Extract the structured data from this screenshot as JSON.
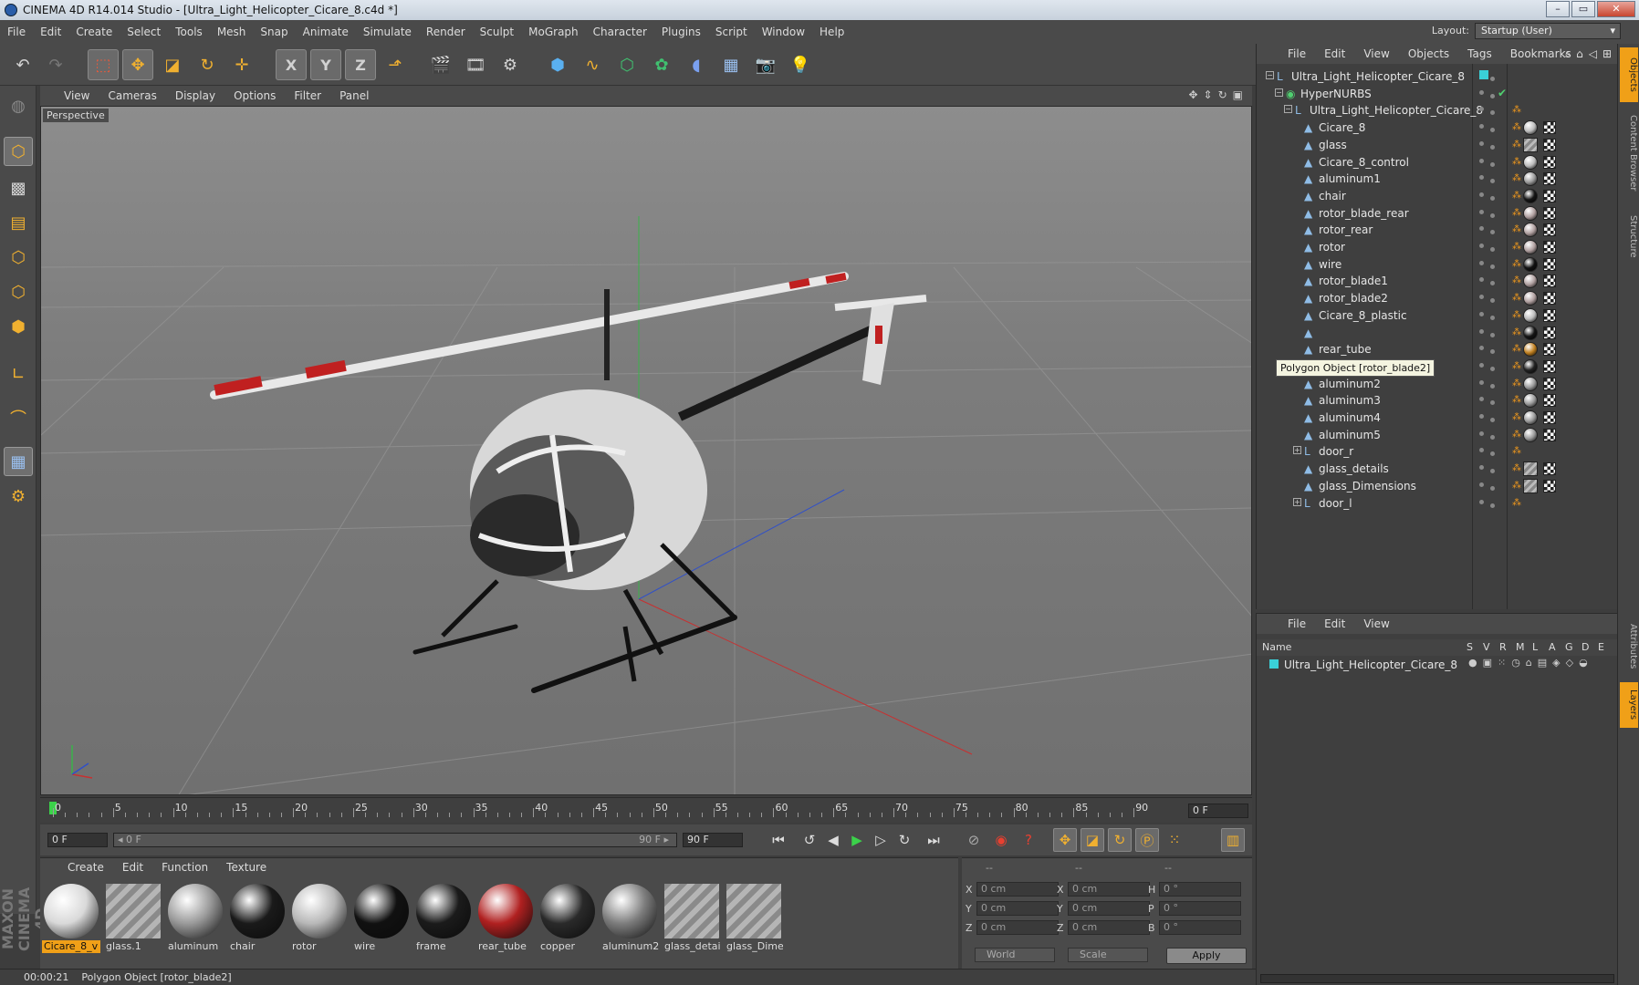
{
  "window": {
    "title": "CINEMA 4D R14.014 Studio - [Ultra_Light_Helicopter_Cicare_8.c4d *]",
    "buttons": [
      "–",
      "▭",
      "✕"
    ]
  },
  "menubar": [
    "File",
    "Edit",
    "Create",
    "Select",
    "Tools",
    "Mesh",
    "Snap",
    "Animate",
    "Simulate",
    "Render",
    "Sculpt",
    "MoGraph",
    "Character",
    "Plugins",
    "Script",
    "Window",
    "Help"
  ],
  "layout": {
    "label": "Layout:",
    "value": "Startup (User)"
  },
  "toolbar_icons": [
    "undo-icon",
    "redo-icon",
    "live-selection-icon",
    "move-icon",
    "scale-icon",
    "rotate-icon",
    "add-icon",
    "x-axis-icon",
    "y-axis-icon",
    "z-axis-icon",
    "coordinate-system-icon",
    "render-view-icon",
    "render-picture-viewer-icon",
    "edit-render-settings-icon",
    "cube-icon",
    "spline-pen-icon",
    "nurbs-icon",
    "array-icon",
    "deformer-icon",
    "floor-icon",
    "camera-icon",
    "light-icon"
  ],
  "toolbar_glyphs": {
    "x_axis": "X",
    "y_axis": "Y",
    "z_axis": "Z"
  },
  "viewport": {
    "menu": [
      "View",
      "Cameras",
      "Display",
      "Options",
      "Filter",
      "Panel"
    ],
    "label": "Perspective"
  },
  "timeline": {
    "ticks": [
      "0",
      "5",
      "10",
      "15",
      "20",
      "25",
      "30",
      "35",
      "40",
      "45",
      "50",
      "55",
      "60",
      "65",
      "70",
      "75",
      "80",
      "85",
      "90"
    ],
    "current_frame": "0 F"
  },
  "transport": {
    "start_frame": "0 F",
    "range_start": "◂ 0 F",
    "range_end": "90 F ▸",
    "end_frame": "90 F"
  },
  "materials": {
    "menu": [
      "Create",
      "Edit",
      "Function",
      "Texture"
    ],
    "items": [
      {
        "label": "Cicare_8_v",
        "color": "#d9d9d9",
        "selected": true
      },
      {
        "label": "glass.1",
        "color": "striped",
        "selected": false
      },
      {
        "label": "aluminum",
        "color": "#9a9a9a",
        "selected": false
      },
      {
        "label": "chair",
        "color": "#1a1a1a",
        "selected": false
      },
      {
        "label": "rotor",
        "color": "#b8b8b8",
        "selected": false
      },
      {
        "label": "wire",
        "color": "#111111",
        "selected": false
      },
      {
        "label": "frame",
        "color": "#1b1b1b",
        "selected": false
      },
      {
        "label": "rear_tube",
        "color": "#b02020",
        "selected": false
      },
      {
        "label": "copper",
        "color": "#2a2a2a",
        "selected": false
      },
      {
        "label": "aluminum2",
        "color": "#7d7d7d",
        "selected": false
      },
      {
        "label": "glass_detai",
        "color": "striped",
        "selected": false
      },
      {
        "label": "glass_Dime",
        "color": "striped",
        "selected": false
      }
    ]
  },
  "coordinates": {
    "headers": [
      "--",
      "--",
      "--"
    ],
    "rows": [
      {
        "a": "X",
        "av": "0 cm",
        "b": "X",
        "bv": "0 cm",
        "c": "H",
        "cv": "0 °"
      },
      {
        "a": "Y",
        "av": "0 cm",
        "b": "Y",
        "bv": "0 cm",
        "c": "P",
        "cv": "0 °"
      },
      {
        "a": "Z",
        "av": "0 cm",
        "b": "Z",
        "bv": "0 cm",
        "c": "B",
        "cv": "0 °"
      }
    ],
    "world": "World",
    "scale": "Scale",
    "apply": "Apply"
  },
  "status": {
    "time": "00:00:21",
    "message": "Polygon Object [rotor_blade2]"
  },
  "objects_panel": {
    "menu": [
      "File",
      "Edit",
      "View",
      "Objects",
      "Tags",
      "Bookmarks"
    ],
    "tree": [
      {
        "name": "Ultra_Light_Helicopter_Cicare_8",
        "depth": 0,
        "icon": "null",
        "tag": "cyan"
      },
      {
        "name": "HyperNURBS",
        "depth": 1,
        "icon": "nurbs",
        "tag": "check"
      },
      {
        "name": "Ultra_Light_Helicopter_Cicare_8",
        "depth": 2,
        "icon": "null",
        "tag": "orange"
      },
      {
        "name": "Cicare_8",
        "depth": 3,
        "icon": "poly",
        "ball": "#bcbcbc"
      },
      {
        "name": "glass",
        "depth": 3,
        "icon": "poly",
        "ball": "striped"
      },
      {
        "name": "Cicare_8_control",
        "depth": 3,
        "icon": "poly",
        "ball": "#bcbcbc"
      },
      {
        "name": "aluminum1",
        "depth": 3,
        "icon": "poly",
        "ball": "#9a9a9a"
      },
      {
        "name": "chair",
        "depth": 3,
        "icon": "poly",
        "ball": "#151515"
      },
      {
        "name": "rotor_blade_rear",
        "depth": 3,
        "icon": "poly",
        "ball": "#b0a0a0"
      },
      {
        "name": "rotor_rear",
        "depth": 3,
        "icon": "poly",
        "ball": "#b0a0a0"
      },
      {
        "name": "rotor",
        "depth": 3,
        "icon": "poly",
        "ball": "#b0a0a0"
      },
      {
        "name": "wire",
        "depth": 3,
        "icon": "poly",
        "ball": "#111111"
      },
      {
        "name": "rotor_blade1",
        "depth": 3,
        "icon": "poly",
        "ball": "#b0a0a0"
      },
      {
        "name": "rotor_blade2",
        "depth": 3,
        "icon": "poly",
        "ball": "#b0a0a0"
      },
      {
        "name": "Cicare_8_plastic",
        "depth": 3,
        "icon": "poly",
        "ball": "#bcbcbc"
      },
      {
        "name": "",
        "depth": 3,
        "icon": "poly",
        "ball": "#151515"
      },
      {
        "name": "rear_tube",
        "depth": 3,
        "icon": "poly",
        "ball": "#c08020"
      },
      {
        "name": "copper",
        "depth": 3,
        "icon": "poly",
        "ball": "#222222"
      },
      {
        "name": "aluminum2",
        "depth": 3,
        "icon": "poly",
        "ball": "#9a9a9a"
      },
      {
        "name": "aluminum3",
        "depth": 3,
        "icon": "poly",
        "ball": "#9a9a9a"
      },
      {
        "name": "aluminum4",
        "depth": 3,
        "icon": "poly",
        "ball": "#9a9a9a"
      },
      {
        "name": "aluminum5",
        "depth": 3,
        "icon": "poly",
        "ball": "#9a9a9a"
      },
      {
        "name": "door_r",
        "depth": 3,
        "icon": "null",
        "expand": "+"
      },
      {
        "name": "glass_details",
        "depth": 3,
        "icon": "poly",
        "ball": "striped"
      },
      {
        "name": "glass_Dimensions",
        "depth": 3,
        "icon": "poly",
        "ball": "striped"
      },
      {
        "name": "door_l",
        "depth": 3,
        "icon": "null",
        "expand": "+"
      }
    ],
    "tooltip": "Polygon Object [rotor_blade2]"
  },
  "layers_panel": {
    "menu": [
      "File",
      "Edit",
      "View"
    ],
    "columns": [
      "Name",
      "S",
      "V",
      "R",
      "M",
      "L",
      "A",
      "G",
      "D",
      "E"
    ],
    "row": "Ultra_Light_Helicopter_Cicare_8"
  },
  "side_tabs": [
    "Objects",
    "Content Browser",
    "Structure",
    "Attributes",
    "Layers"
  ],
  "brand": "MAXON CINEMA 4D"
}
